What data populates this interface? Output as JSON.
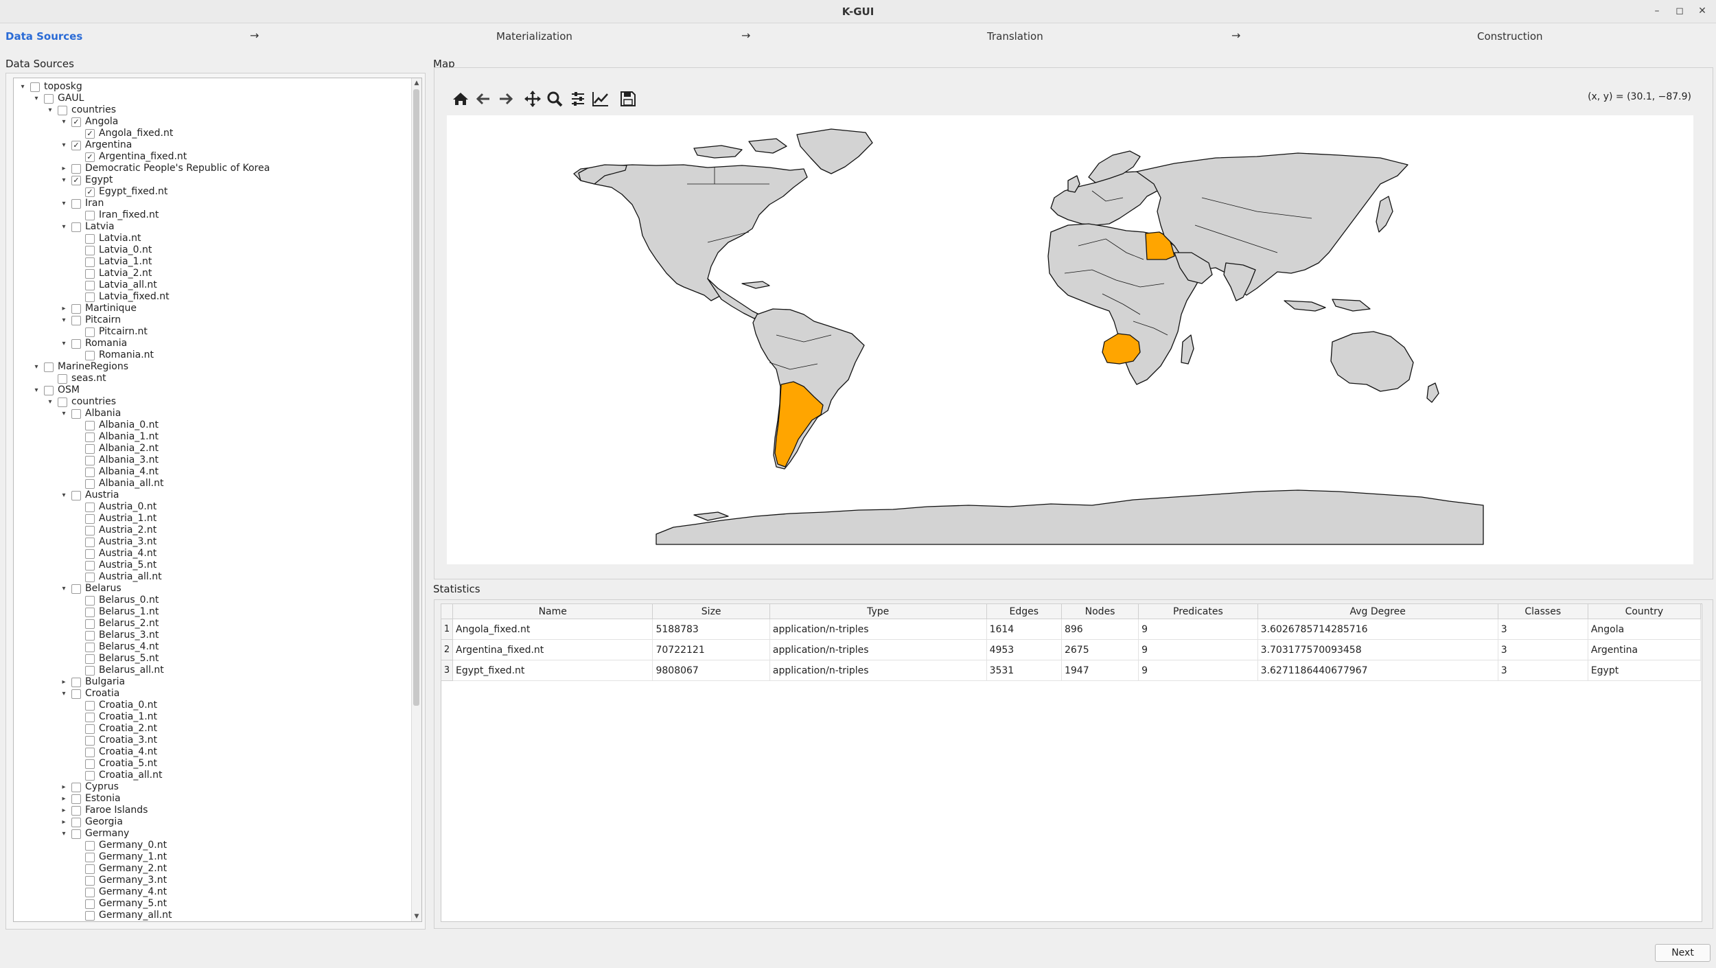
{
  "window": {
    "title": "K-GUI",
    "minimize": "–",
    "maximize": "◻",
    "close": "✕"
  },
  "steps": [
    {
      "label": "Data Sources",
      "active": true
    },
    {
      "label": "Materialization",
      "active": false
    },
    {
      "label": "Translation",
      "active": false
    },
    {
      "label": "Construction",
      "active": false
    }
  ],
  "step_arrow": "→",
  "left": {
    "label": "Data Sources"
  },
  "tree": [
    {
      "depth": 0,
      "label": "toposkg",
      "toggle": "open",
      "checked": false
    },
    {
      "depth": 1,
      "label": "GAUL",
      "toggle": "open",
      "checked": false
    },
    {
      "depth": 2,
      "label": "countries",
      "toggle": "open",
      "checked": false
    },
    {
      "depth": 3,
      "label": "Angola",
      "toggle": "open",
      "checked": true
    },
    {
      "depth": 4,
      "label": "Angola_fixed.nt",
      "toggle": "none",
      "checked": true
    },
    {
      "depth": 3,
      "label": "Argentina",
      "toggle": "open",
      "checked": true
    },
    {
      "depth": 4,
      "label": "Argentina_fixed.nt",
      "toggle": "none",
      "checked": true
    },
    {
      "depth": 3,
      "label": "Democratic People's Republic of Korea",
      "toggle": "closed",
      "checked": false
    },
    {
      "depth": 3,
      "label": "Egypt",
      "toggle": "open",
      "checked": true
    },
    {
      "depth": 4,
      "label": "Egypt_fixed.nt",
      "toggle": "none",
      "checked": true
    },
    {
      "depth": 3,
      "label": "Iran",
      "toggle": "open",
      "checked": false
    },
    {
      "depth": 4,
      "label": "Iran_fixed.nt",
      "toggle": "none",
      "checked": false
    },
    {
      "depth": 3,
      "label": "Latvia",
      "toggle": "open",
      "checked": false
    },
    {
      "depth": 4,
      "label": "Latvia.nt",
      "toggle": "none",
      "checked": false
    },
    {
      "depth": 4,
      "label": "Latvia_0.nt",
      "toggle": "none",
      "checked": false
    },
    {
      "depth": 4,
      "label": "Latvia_1.nt",
      "toggle": "none",
      "checked": false
    },
    {
      "depth": 4,
      "label": "Latvia_2.nt",
      "toggle": "none",
      "checked": false
    },
    {
      "depth": 4,
      "label": "Latvia_all.nt",
      "toggle": "none",
      "checked": false
    },
    {
      "depth": 4,
      "label": "Latvia_fixed.nt",
      "toggle": "none",
      "checked": false
    },
    {
      "depth": 3,
      "label": "Martinique",
      "toggle": "closed",
      "checked": false
    },
    {
      "depth": 3,
      "label": "Pitcairn",
      "toggle": "open",
      "checked": false
    },
    {
      "depth": 4,
      "label": "Pitcairn.nt",
      "toggle": "none",
      "checked": false
    },
    {
      "depth": 3,
      "label": "Romania",
      "toggle": "open",
      "checked": false
    },
    {
      "depth": 4,
      "label": "Romania.nt",
      "toggle": "none",
      "checked": false
    },
    {
      "depth": 1,
      "label": "MarineRegions",
      "toggle": "open",
      "checked": false
    },
    {
      "depth": 2,
      "label": "seas.nt",
      "toggle": "none",
      "checked": false
    },
    {
      "depth": 1,
      "label": "OSM",
      "toggle": "open",
      "checked": false
    },
    {
      "depth": 2,
      "label": "countries",
      "toggle": "open",
      "checked": false
    },
    {
      "depth": 3,
      "label": "Albania",
      "toggle": "open",
      "checked": false
    },
    {
      "depth": 4,
      "label": "Albania_0.nt",
      "toggle": "none",
      "checked": false
    },
    {
      "depth": 4,
      "label": "Albania_1.nt",
      "toggle": "none",
      "checked": false
    },
    {
      "depth": 4,
      "label": "Albania_2.nt",
      "toggle": "none",
      "checked": false
    },
    {
      "depth": 4,
      "label": "Albania_3.nt",
      "toggle": "none",
      "checked": false
    },
    {
      "depth": 4,
      "label": "Albania_4.nt",
      "toggle": "none",
      "checked": false
    },
    {
      "depth": 4,
      "label": "Albania_all.nt",
      "toggle": "none",
      "checked": false
    },
    {
      "depth": 3,
      "label": "Austria",
      "toggle": "open",
      "checked": false
    },
    {
      "depth": 4,
      "label": "Austria_0.nt",
      "toggle": "none",
      "checked": false
    },
    {
      "depth": 4,
      "label": "Austria_1.nt",
      "toggle": "none",
      "checked": false
    },
    {
      "depth": 4,
      "label": "Austria_2.nt",
      "toggle": "none",
      "checked": false
    },
    {
      "depth": 4,
      "label": "Austria_3.nt",
      "toggle": "none",
      "checked": false
    },
    {
      "depth": 4,
      "label": "Austria_4.nt",
      "toggle": "none",
      "checked": false
    },
    {
      "depth": 4,
      "label": "Austria_5.nt",
      "toggle": "none",
      "checked": false
    },
    {
      "depth": 4,
      "label": "Austria_all.nt",
      "toggle": "none",
      "checked": false
    },
    {
      "depth": 3,
      "label": "Belarus",
      "toggle": "open",
      "checked": false
    },
    {
      "depth": 4,
      "label": "Belarus_0.nt",
      "toggle": "none",
      "checked": false
    },
    {
      "depth": 4,
      "label": "Belarus_1.nt",
      "toggle": "none",
      "checked": false
    },
    {
      "depth": 4,
      "label": "Belarus_2.nt",
      "toggle": "none",
      "checked": false
    },
    {
      "depth": 4,
      "label": "Belarus_3.nt",
      "toggle": "none",
      "checked": false
    },
    {
      "depth": 4,
      "label": "Belarus_4.nt",
      "toggle": "none",
      "checked": false
    },
    {
      "depth": 4,
      "label": "Belarus_5.nt",
      "toggle": "none",
      "checked": false
    },
    {
      "depth": 4,
      "label": "Belarus_all.nt",
      "toggle": "none",
      "checked": false
    },
    {
      "depth": 3,
      "label": "Bulgaria",
      "toggle": "closed",
      "checked": false
    },
    {
      "depth": 3,
      "label": "Croatia",
      "toggle": "open",
      "checked": false
    },
    {
      "depth": 4,
      "label": "Croatia_0.nt",
      "toggle": "none",
      "checked": false
    },
    {
      "depth": 4,
      "label": "Croatia_1.nt",
      "toggle": "none",
      "checked": false
    },
    {
      "depth": 4,
      "label": "Croatia_2.nt",
      "toggle": "none",
      "checked": false
    },
    {
      "depth": 4,
      "label": "Croatia_3.nt",
      "toggle": "none",
      "checked": false
    },
    {
      "depth": 4,
      "label": "Croatia_4.nt",
      "toggle": "none",
      "checked": false
    },
    {
      "depth": 4,
      "label": "Croatia_5.nt",
      "toggle": "none",
      "checked": false
    },
    {
      "depth": 4,
      "label": "Croatia_all.nt",
      "toggle": "none",
      "checked": false
    },
    {
      "depth": 3,
      "label": "Cyprus",
      "toggle": "closed",
      "checked": false
    },
    {
      "depth": 3,
      "label": "Estonia",
      "toggle": "closed",
      "checked": false
    },
    {
      "depth": 3,
      "label": "Faroe Islands",
      "toggle": "closed",
      "checked": false
    },
    {
      "depth": 3,
      "label": "Georgia",
      "toggle": "closed",
      "checked": false
    },
    {
      "depth": 3,
      "label": "Germany",
      "toggle": "open",
      "checked": false
    },
    {
      "depth": 4,
      "label": "Germany_0.nt",
      "toggle": "none",
      "checked": false
    },
    {
      "depth": 4,
      "label": "Germany_1.nt",
      "toggle": "none",
      "checked": false
    },
    {
      "depth": 4,
      "label": "Germany_2.nt",
      "toggle": "none",
      "checked": false
    },
    {
      "depth": 4,
      "label": "Germany_3.nt",
      "toggle": "none",
      "checked": false
    },
    {
      "depth": 4,
      "label": "Germany_4.nt",
      "toggle": "none",
      "checked": false
    },
    {
      "depth": 4,
      "label": "Germany_5.nt",
      "toggle": "none",
      "checked": false
    },
    {
      "depth": 4,
      "label": "Germany_all.nt",
      "toggle": "none",
      "checked": false
    }
  ],
  "map": {
    "label": "Map",
    "coords": "(x, y) = (30.1, −87.9)",
    "toolbar": [
      "home-icon",
      "back-arrow-icon",
      "forward-arrow-icon",
      "pan-icon",
      "zoom-icon",
      "configure-subplots-icon",
      "edit-axis-icon",
      "save-icon"
    ],
    "land_color": "#d3d3d3",
    "highlight_color": "#ffa500",
    "highlighted": [
      "Angola",
      "Argentina",
      "Egypt"
    ]
  },
  "stats": {
    "label": "Statistics",
    "columns": [
      "Name",
      "Size",
      "Type",
      "Edges",
      "Nodes",
      "Predicates",
      "Avg Degree",
      "Classes",
      "Country"
    ],
    "rows": [
      {
        "index": "1",
        "cells": [
          "Angola_fixed.nt",
          "5188783",
          "application/n-triples",
          "1614",
          "896",
          "9",
          "3.6026785714285716",
          "3",
          "Angola"
        ]
      },
      {
        "index": "2",
        "cells": [
          "Argentina_fixed.nt",
          "70722121",
          "application/n-triples",
          "4953",
          "2675",
          "9",
          "3.703177570093458",
          "3",
          "Argentina"
        ]
      },
      {
        "index": "3",
        "cells": [
          "Egypt_fixed.nt",
          "9808067",
          "application/n-triples",
          "3531",
          "1947",
          "9",
          "3.6271186440677967",
          "3",
          "Egypt"
        ]
      }
    ]
  },
  "next_label": "Next"
}
